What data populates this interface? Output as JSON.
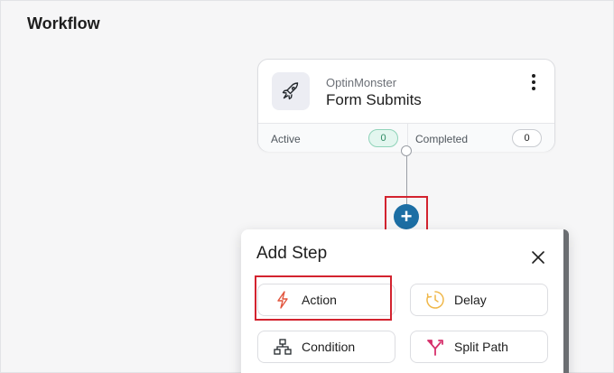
{
  "page": {
    "title": "Workflow"
  },
  "trigger": {
    "source": "OptinMonster",
    "name": "Form Submits",
    "icon": "rocket-icon",
    "active_label": "Active",
    "active_count": "0",
    "completed_label": "Completed",
    "completed_count": "0"
  },
  "add_button": {
    "symbol": "+",
    "icon": "plus-icon"
  },
  "add_step": {
    "title": "Add Step",
    "options": [
      {
        "label": "Action",
        "icon": "lightning-icon",
        "color": "#e2553d"
      },
      {
        "label": "Delay",
        "icon": "clock-icon",
        "color": "#f0b84a"
      },
      {
        "label": "Condition",
        "icon": "hierarchy-icon",
        "color": "#23282d"
      },
      {
        "label": "Split Path",
        "icon": "split-arrows-icon",
        "color": "#d6306b"
      }
    ]
  },
  "colors": {
    "accent": "#1c6ea4",
    "highlight": "#d3232f",
    "active_badge": "#2d8a63"
  }
}
